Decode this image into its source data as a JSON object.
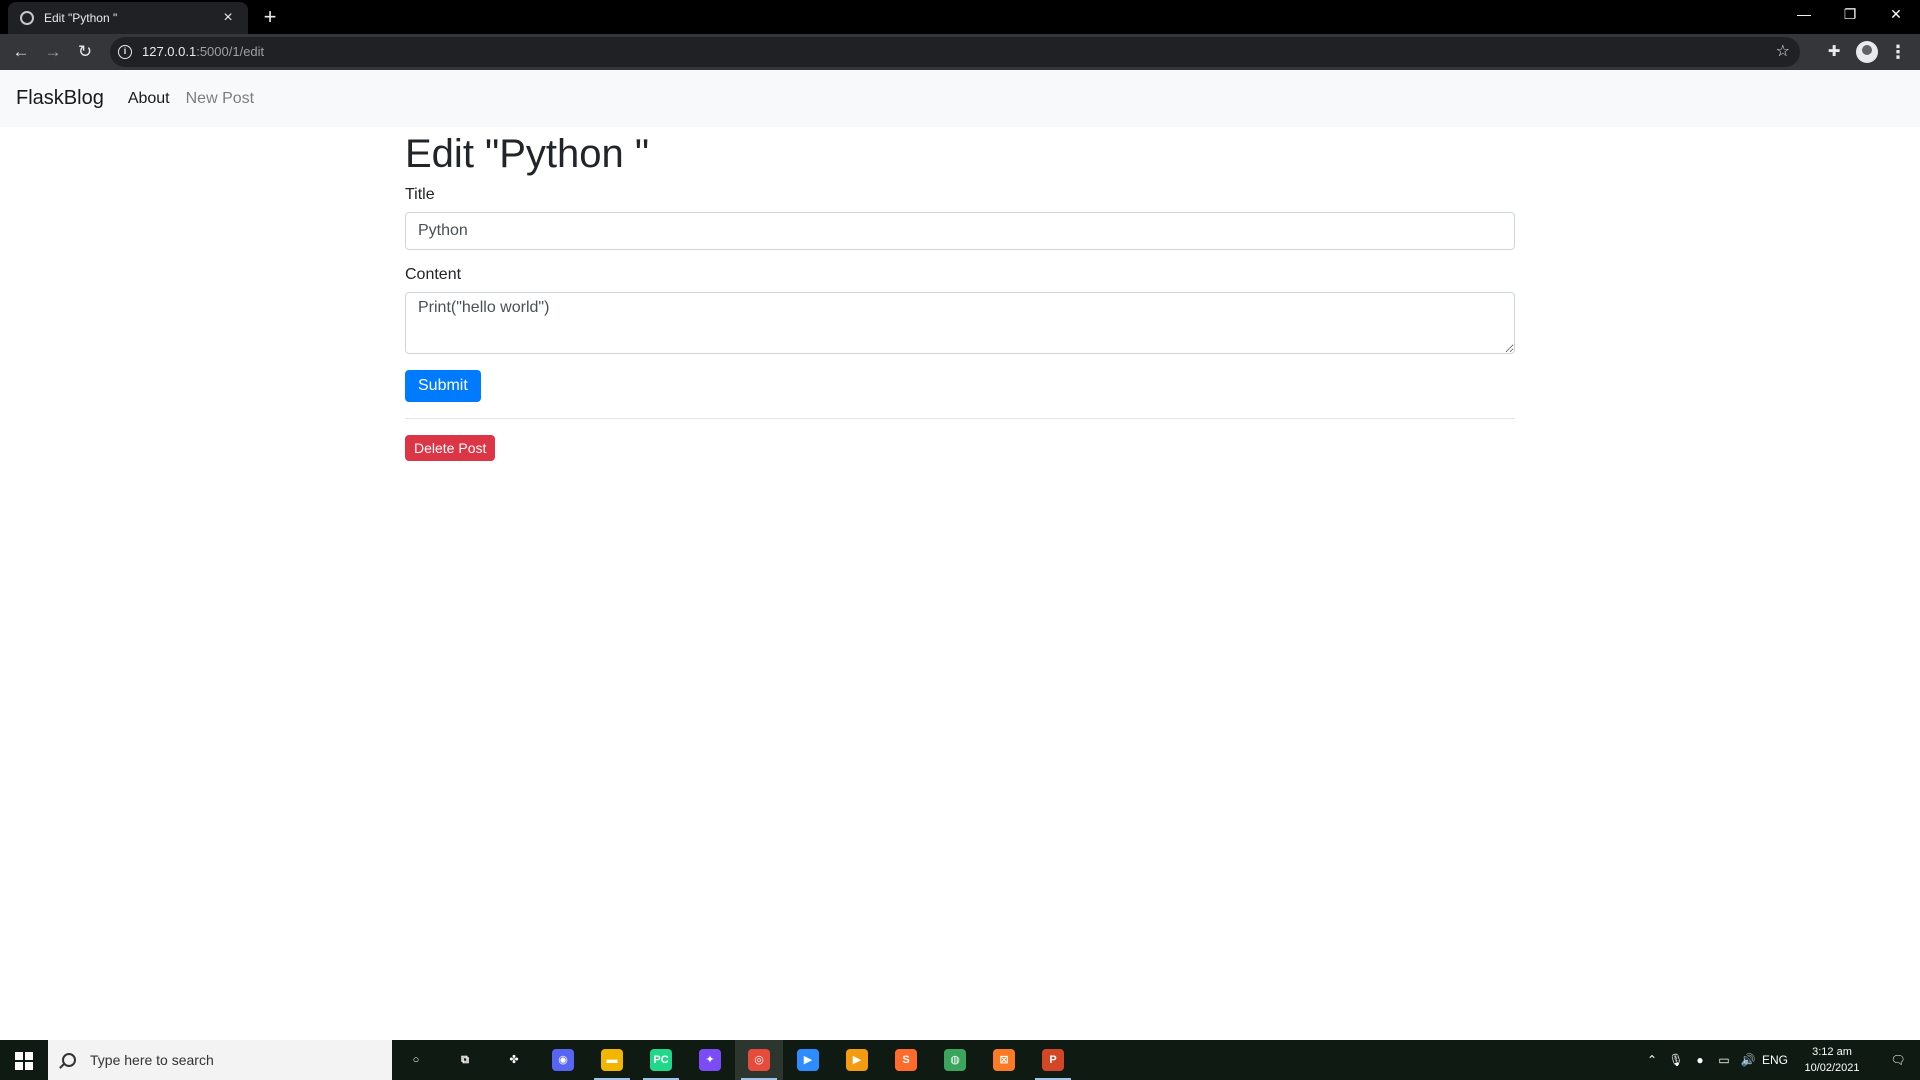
{
  "browser": {
    "tab_title": "Edit \"Python \"",
    "tab_close": "×",
    "new_tab": "+",
    "url_host": "127.0.0.1",
    "url_rest": ":5000/1/edit",
    "window_controls": {
      "minimize": "—",
      "restore": "❐",
      "close": "✕"
    }
  },
  "navbar": {
    "brand": "FlaskBlog",
    "links": [
      {
        "label": "About",
        "state": "normal"
      },
      {
        "label": "New Post",
        "state": "muted"
      }
    ]
  },
  "page": {
    "heading": "Edit \"Python \"",
    "form": {
      "title_label": "Title",
      "title_value": "Python",
      "content_label": "Content",
      "content_value": "Print(\"hello world\")",
      "submit_label": "Submit"
    },
    "delete_label": "Delete Post"
  },
  "taskbar": {
    "search_placeholder": "Type here to search",
    "apps": [
      {
        "name": "cortana-icon",
        "glyph": "○",
        "color": "transparent"
      },
      {
        "name": "task-view-icon",
        "glyph": "⧉",
        "color": "transparent"
      },
      {
        "name": "game-icon",
        "glyph": "✤",
        "color": "transparent"
      },
      {
        "name": "discord-icon",
        "glyph": "◉",
        "color": "#5865f2"
      },
      {
        "name": "file-explorer-icon",
        "glyph": "▬",
        "color": "#f2b600"
      },
      {
        "name": "pycharm-icon",
        "glyph": "PC",
        "color": "#21d789"
      },
      {
        "name": "messenger-icon",
        "glyph": "✦",
        "color": "#7b4cf5"
      },
      {
        "name": "chrome-icon",
        "glyph": "◎",
        "color": "#e64b3c"
      },
      {
        "name": "zoom-icon",
        "glyph": "▶",
        "color": "#2d8cff"
      },
      {
        "name": "media-player-icon",
        "glyph": "▶",
        "color": "#f39c12"
      },
      {
        "name": "sublime-icon",
        "glyph": "S",
        "color": "#ff6b2b"
      },
      {
        "name": "anaconda-icon",
        "glyph": "◍",
        "color": "#3ba55d"
      },
      {
        "name": "xampp-icon",
        "glyph": "⊠",
        "color": "#fb7a24"
      },
      {
        "name": "powerpoint-icon",
        "glyph": "P",
        "color": "#d24726"
      }
    ],
    "tray": {
      "language": "ENG",
      "time": "3:12 am",
      "date": "10/02/2021"
    }
  }
}
